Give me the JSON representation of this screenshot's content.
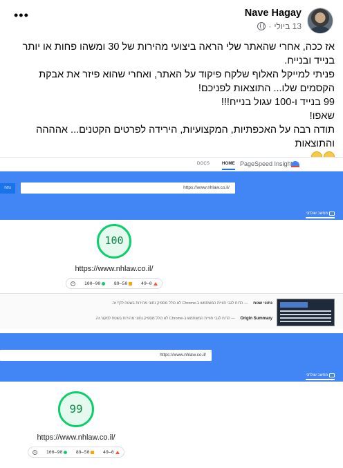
{
  "post": {
    "author": "Nave Hagay",
    "timestamp": "13 ביולי",
    "separator": "·",
    "more_label": "•••",
    "avatar_icon": "profile-photo",
    "privacy_icon": "globe-icon",
    "paragraphs": [
      "אז ככה, אחרי שהאתר שלי הראה ביצועי מהירות של 30 ומשהו פחות או יותר בנייד ובנייח.",
      "פניתי למייקל האלוף שלקח פיקוד על האתר, ואחרי שהוא פיזר את אבקת הקסמים שלו... התוצאות לפניכם!",
      "99 בנייד ו-100 עגול בנייח!!!",
      "שאפו!",
      "תודה רבה על האכפתיות, המקצועיות, הירידה לפרטים הקטנים... אהההה והתוצאות"
    ],
    "emojis": [
      "grinning-face-emoji",
      "winking-face-emoji"
    ]
  },
  "screenshot": {
    "topbar": {
      "tab_docs": "DOCS",
      "tab_home": "HOME",
      "brand": "PageSpeed Insights",
      "logo_icon": "pagespeed-logo-icon"
    },
    "desktop_panel": {
      "url_value": "https://www.nhlaw.co.il/",
      "analyze_label": "נתח",
      "device_tab": "מחשב שולחני",
      "device_icon": "monitor-icon",
      "score": "100",
      "url_display": "https://www.nhlaw.co.il/"
    },
    "legend": {
      "good": "100–90",
      "average": "89–50",
      "poor": "49–0"
    },
    "summary": {
      "field_label": "נתוני שטח",
      "field_text": "— הדוח לגבי חוויית המשתמש ב-Chrome לא כולל מספיק נתוני מהירות בשטח לדף זה.",
      "origin_label": "Origin Summary",
      "origin_text": "— הדוח לגבי חוויית המשתמש ב-Chrome לא כולל מספיק נתוני מהירות בשטח למקור זה."
    },
    "mobile_panel": {
      "url_value": "https://www.nhlaw.co.il/",
      "device_tab": "מחשב שולחני",
      "score": "99",
      "url_display": "https://www.nhlaw.co.il/"
    },
    "colors": {
      "band_blue": "#4285f4",
      "score_green": "#0cce6b",
      "average_orange": "#ffa400",
      "poor_red": "#ff4e42"
    }
  }
}
